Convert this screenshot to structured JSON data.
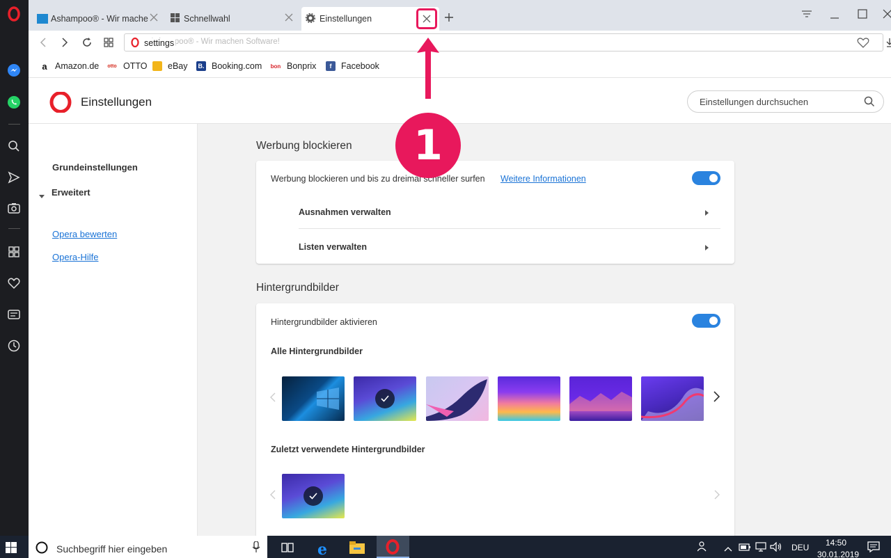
{
  "tabs": [
    {
      "label": "Ashampoo® - Wir machen Software!"
    },
    {
      "label": "Schnellwahl"
    },
    {
      "label": "Einstellungen"
    }
  ],
  "address": {
    "value": "settings",
    "ghost": "Ashampoo® - Wir machen Software!"
  },
  "bookmarks": [
    {
      "label": "Amazon.de"
    },
    {
      "label": "OTTO"
    },
    {
      "label": "eBay"
    },
    {
      "label": "Booking.com"
    },
    {
      "label": "Bonprix"
    },
    {
      "label": "Facebook"
    }
  ],
  "settings": {
    "title": "Einstellungen",
    "search_placeholder": "Einstellungen durchsuchen"
  },
  "nav": {
    "basic": "Grundeinstellungen",
    "advanced": "Erweitert",
    "rate": "Opera bewerten",
    "help": "Opera-Hilfe"
  },
  "adblock": {
    "section_title": "Werbung blockieren",
    "toggle_label": "Werbung blockieren und bis zu dreimal schneller surfen",
    "more_info": "Weitere Informationen",
    "toggle_on": true,
    "exceptions": "Ausnahmen verwalten",
    "lists": "Listen verwalten"
  },
  "wallpapers": {
    "section_title": "Hintergrundbilder",
    "toggle_label": "Hintergrundbilder aktivieren",
    "toggle_on": true,
    "all_label": "Alle Hintergrundbilder",
    "recent_label": "Zuletzt verwendete Hintergrundbilder",
    "selected_index": 1
  },
  "annotation": {
    "number": "1",
    "color": "#e8185c"
  },
  "taskbar": {
    "search": "Suchbegriff hier eingeben",
    "lang": "DEU",
    "time": "14:50",
    "date": "30.01.2019"
  }
}
